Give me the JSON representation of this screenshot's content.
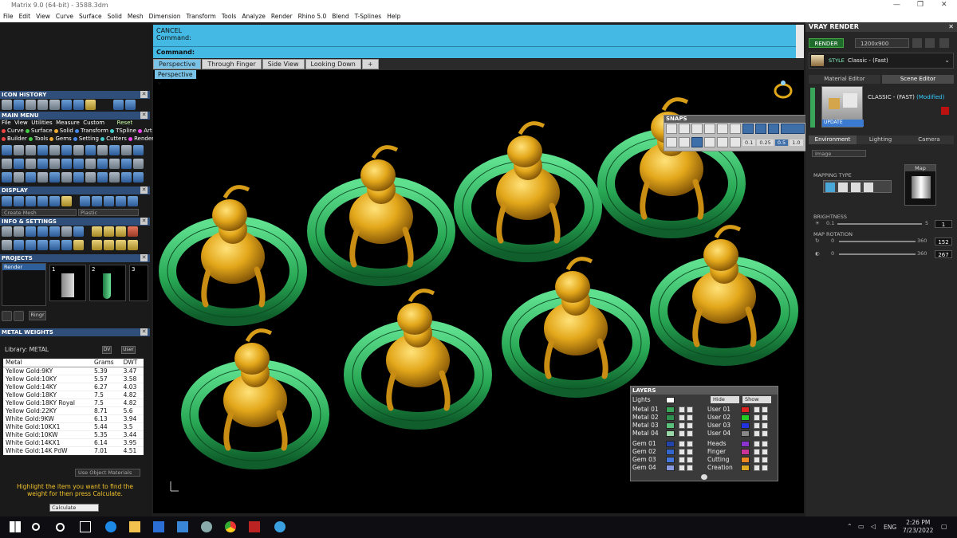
{
  "window": {
    "title": "Matrix 9.0 (64-bit) - 3588.3dm",
    "controls": [
      "—",
      "❐",
      "✕"
    ]
  },
  "menu": [
    "File",
    "Edit",
    "View",
    "Curve",
    "Surface",
    "Solid",
    "Mesh",
    "Dimension",
    "Transform",
    "Tools",
    "Analyze",
    "Render",
    "Rhino 5.0",
    "Blend",
    "T-Splines",
    "Help"
  ],
  "command": {
    "line1": "CANCEL",
    "line2": "Command:",
    "prompt": "Command:"
  },
  "viewport_tabs": [
    "Perspective",
    "Through Finger",
    "Side View",
    "Looking Down",
    "+"
  ],
  "active_view": "Perspective",
  "left": {
    "icon_history": "ICON HISTORY",
    "main_menu": "MAIN MENU",
    "main_menu_row1": [
      "File",
      "View",
      "Utilities",
      "Measure",
      "Custom"
    ],
    "reset": "Reset",
    "main_menu_row2": [
      "Curve",
      "Surface",
      "Solid",
      "Transform",
      "TSpline",
      "Art"
    ],
    "main_menu_row3": [
      "Builder",
      "Tools",
      "Gems",
      "Setting",
      "Cutters",
      "Render"
    ],
    "display": "DISPLAY",
    "display_left_dd": "Create Mesh",
    "display_right_dd": "Plastic",
    "info_settings": "INFO & SETTINGS",
    "projects": "PROJECTS",
    "project_item": "Render",
    "project_thumbs": [
      "1",
      "2",
      "3"
    ],
    "ring_btn": "Ringr"
  },
  "metal_weights": {
    "title": "METAL WEIGHTS",
    "library": "Library: METAL",
    "unit_btn": "DV",
    "user_btn": "User",
    "columns": [
      "Metal",
      "Grams",
      "DWT"
    ],
    "rows": [
      [
        "Yellow Gold:9KY",
        "5.39",
        "3.47"
      ],
      [
        "Yellow Gold:10KY",
        "5.57",
        "3.58"
      ],
      [
        "Yellow Gold:14KY",
        "6.27",
        "4.03"
      ],
      [
        "Yellow Gold:18KY",
        "7.5",
        "4.82"
      ],
      [
        "Yellow Gold:18KY Royal",
        "7.5",
        "4.82"
      ],
      [
        "Yellow Gold:22KY",
        "8.71",
        "5.6"
      ],
      [
        "White Gold:9KW",
        "6.13",
        "3.94"
      ],
      [
        "White Gold:10KX1",
        "5.44",
        "3.5"
      ],
      [
        "White Gold:10KW",
        "5.35",
        "3.44"
      ],
      [
        "White Gold:14KX1",
        "6.14",
        "3.95"
      ],
      [
        "White Gold:14K PdW",
        "7.01",
        "4.51"
      ]
    ],
    "use_object_materials": "Use Object Materials",
    "hint": "Highlight the item you want to find the weight for then press Calculate.",
    "calculate": "Calculate"
  },
  "snaps": {
    "title": "SNAPS",
    "values": [
      "0.1",
      "0.25",
      "0.5",
      "1.0"
    ]
  },
  "layers": {
    "title": "LAYERS",
    "lights": "Lights",
    "hide": "Hide",
    "show": "Show",
    "left": [
      {
        "name": "Metal 01",
        "color": "#3aa65a"
      },
      {
        "name": "Metal 02",
        "color": "#2f8f4f"
      },
      {
        "name": "Metal 03",
        "color": "#5bc07a"
      },
      {
        "name": "Metal 04",
        "color": "#9ad8a8"
      },
      {
        "name": "Gem 01",
        "color": "#2244aa"
      },
      {
        "name": "Gem 02",
        "color": "#3366cc"
      },
      {
        "name": "Gem 03",
        "color": "#4477dd"
      },
      {
        "name": "Gem 04",
        "color": "#8899dd"
      }
    ],
    "right": [
      {
        "name": "User 01",
        "color": "#dd2222"
      },
      {
        "name": "User 02",
        "color": "#22cc22"
      },
      {
        "name": "User 03",
        "color": "#2233dd"
      },
      {
        "name": "User 04",
        "color": "#888888"
      },
      {
        "name": "Heads",
        "color": "#8833cc"
      },
      {
        "name": "Finger",
        "color": "#cc3399"
      },
      {
        "name": "Cutting",
        "color": "#ee8822"
      },
      {
        "name": "Creation",
        "color": "#ddaa22"
      }
    ]
  },
  "vray": {
    "title": "VRAY RENDER",
    "render_btn": "RENDER",
    "resolution": "1200x900",
    "style_label": "STYLE",
    "style_value": "Classic - (Fast)",
    "tab_material": "Material Editor",
    "tab_scene": "Scene Editor",
    "preset": "CLASSIC - (FAST)",
    "modified": "(Modified)",
    "update": "UPDATE",
    "env_tabs": [
      "Environment",
      "Lighting",
      "Camera"
    ],
    "env_dd": "Image",
    "mapping_type": "MAPPING TYPE",
    "map": "Map",
    "brightness": "BRIGHTNESS",
    "bright_min": "0.1",
    "bright_max": "5",
    "bright_val": "1",
    "map_rotation": "MAP ROTATION",
    "rot1_min": "0",
    "rot1_max": "360",
    "rot1_val": "152",
    "rot2_min": "0",
    "rot2_max": "360",
    "rot2_val": "267"
  },
  "taskbar": {
    "lang": "ENG",
    "time": "2:26 PM",
    "date": "7/23/2022"
  },
  "colors": {
    "accent_blue": "#43b9e4",
    "ring_green": "#2fae5a",
    "gold": "#e0a818"
  }
}
